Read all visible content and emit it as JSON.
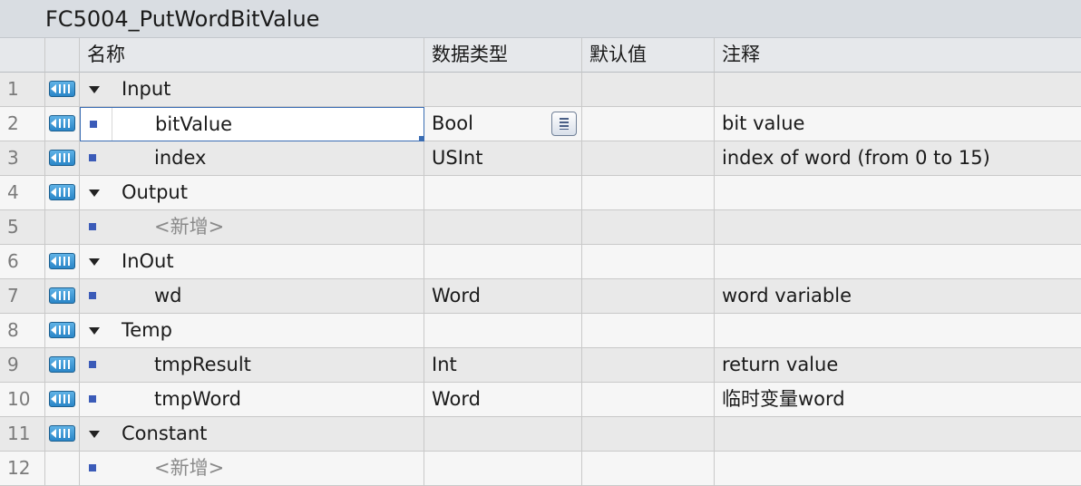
{
  "block_title": "FC5004_PutWordBitValue",
  "columns": {
    "name": "名称",
    "data_type": "数据类型",
    "default_value": "默认值",
    "comment": "注释"
  },
  "rows": [
    {
      "num": "1",
      "kind": "section",
      "icon": "input-direction-icon",
      "name": "Input",
      "type": "",
      "default": "",
      "comment": ""
    },
    {
      "num": "2",
      "kind": "member",
      "icon": "input-direction-icon",
      "name": "bitValue",
      "type": "Bool",
      "default": "",
      "comment": "bit value",
      "selected": true
    },
    {
      "num": "3",
      "kind": "member",
      "icon": "input-direction-icon",
      "name": "index",
      "type": "USInt",
      "default": "",
      "comment": "index of word (from 0 to 15)"
    },
    {
      "num": "4",
      "kind": "section",
      "icon": "output-direction-icon",
      "name": "Output",
      "type": "",
      "default": "",
      "comment": ""
    },
    {
      "num": "5",
      "kind": "member",
      "icon": "",
      "name": "<新增>",
      "type": "",
      "default": "",
      "comment": "",
      "placeholder": true
    },
    {
      "num": "6",
      "kind": "section",
      "icon": "inout-direction-icon",
      "name": "InOut",
      "type": "",
      "default": "",
      "comment": ""
    },
    {
      "num": "7",
      "kind": "member",
      "icon": "inout-direction-icon",
      "name": "wd",
      "type": "Word",
      "default": "",
      "comment": "word variable"
    },
    {
      "num": "8",
      "kind": "section",
      "icon": "temp-direction-icon",
      "name": "Temp",
      "type": "",
      "default": "",
      "comment": ""
    },
    {
      "num": "9",
      "kind": "member",
      "icon": "temp-direction-icon",
      "name": "tmpResult",
      "type": "Int",
      "default": "",
      "comment": "return value"
    },
    {
      "num": "10",
      "kind": "member",
      "icon": "temp-direction-icon",
      "name": "tmpWord",
      "type": "Word",
      "default": "",
      "comment": "临时变量word"
    },
    {
      "num": "11",
      "kind": "section",
      "icon": "constant-direction-icon",
      "name": "Constant",
      "type": "",
      "default": "",
      "comment": ""
    },
    {
      "num": "12",
      "kind": "member",
      "icon": "",
      "name": "<新增>",
      "type": "",
      "default": "",
      "comment": "",
      "placeholder": true
    }
  ],
  "colors": {
    "selection_border": "#3b6db3",
    "bullet": "#3b5bb8",
    "icon_fill": "#2a86c8"
  }
}
